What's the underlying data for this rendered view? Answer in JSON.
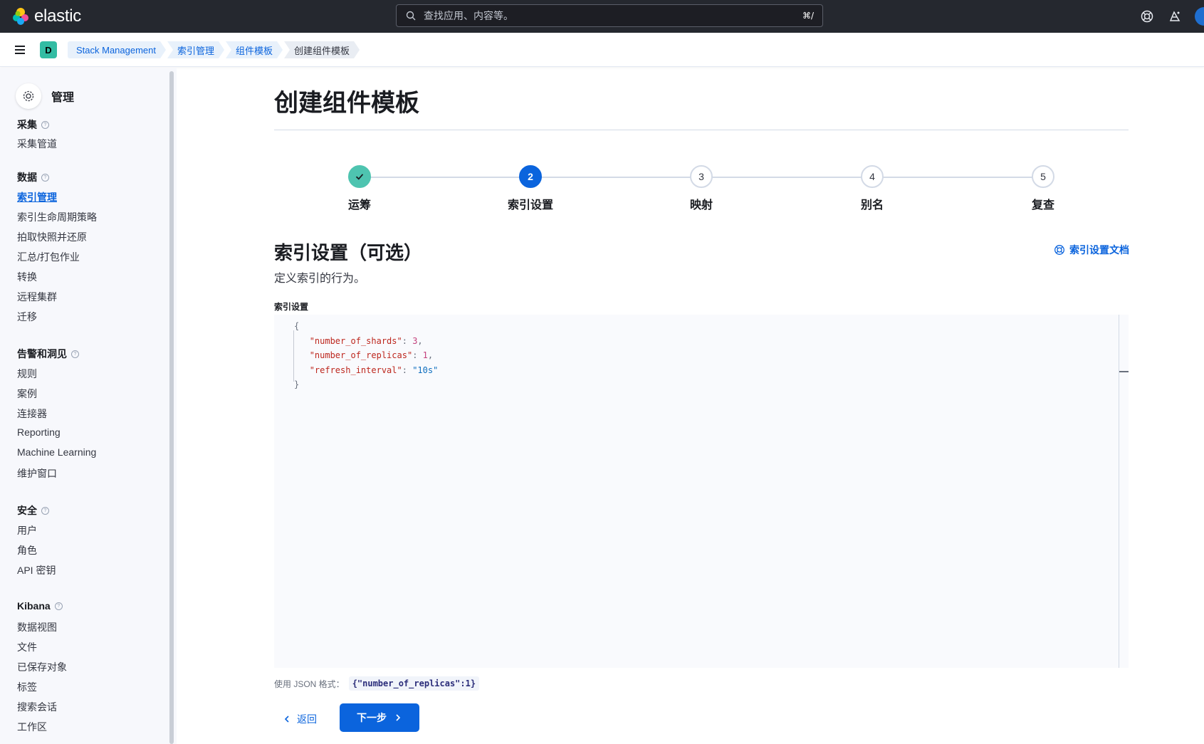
{
  "header": {
    "brand": "elastic",
    "search_placeholder": "查找应用、内容等。",
    "search_shortcut": "⌘/"
  },
  "subbar": {
    "space_initial": "D",
    "breadcrumbs": [
      "Stack Management",
      "索引管理",
      "组件模板",
      "创建组件模板"
    ]
  },
  "sidebar": {
    "title": "管理",
    "sections": [
      {
        "label": "采集",
        "items": [
          "采集管道"
        ]
      },
      {
        "label": "数据",
        "items": [
          "索引管理",
          "索引生命周期策略",
          "拍取快照并还原",
          "汇总/打包作业",
          "转换",
          "远程集群",
          "迁移"
        ]
      },
      {
        "label": "告警和洞见",
        "items": [
          "规则",
          "案例",
          "连接器",
          "Reporting",
          "Machine Learning",
          "维护窗口"
        ]
      },
      {
        "label": "安全",
        "items": [
          "用户",
          "角色",
          "API 密钥"
        ]
      },
      {
        "label": "Kibana",
        "items": [
          "数据视图",
          "文件",
          "已保存对象",
          "标签",
          "搜索会话",
          "工作区"
        ]
      }
    ]
  },
  "main": {
    "page_title": "创建组件模板",
    "steps": [
      {
        "number": "1",
        "label": "运筹",
        "status": "complete"
      },
      {
        "number": "2",
        "label": "索引设置",
        "status": "current"
      },
      {
        "number": "3",
        "label": "映射",
        "status": "incomplete"
      },
      {
        "number": "4",
        "label": "别名",
        "status": "incomplete"
      },
      {
        "number": "5",
        "label": "复查",
        "status": "incomplete"
      }
    ],
    "section_title": "索引设置（可选）",
    "section_description": "定义索引的行为。",
    "doc_link": "索引设置文档",
    "field_label": "索引设置",
    "editor_lines": {
      "open": "{",
      "l1_key": "\"number_of_shards\"",
      "l1_val": "3",
      "l2_key": "\"number_of_replicas\"",
      "l2_val": "1",
      "l3_key": "\"refresh_interval\"",
      "l3_val": "\"10s\"",
      "close": "}"
    },
    "help_text": "使用 JSON 格式：",
    "help_code": "{\"number_of_replicas\":1}",
    "back_button": "返回",
    "next_button": "下一步"
  },
  "colors": {
    "topbar": "#25282f",
    "primary": "#0b64dd",
    "success": "#4ec4b0",
    "space_badge": "#33bca3"
  }
}
